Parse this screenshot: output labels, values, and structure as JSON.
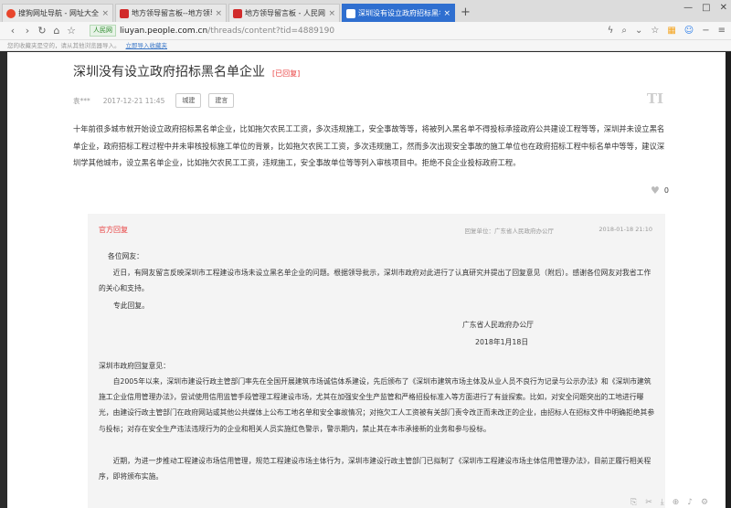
{
  "browser": {
    "tabs": [
      {
        "title": "搜狗网址导航 - 网址大全,实用",
        "favicon_color": "#e8452c",
        "active": false
      },
      {
        "title": "地方领导留言板--地方领导--人民",
        "favicon_color": "#d12b2b",
        "active": false
      },
      {
        "title": "地方领导留言板 - 人民网",
        "favicon_color": "#d12b2b",
        "active": false
      },
      {
        "title": "深圳没有设立政府招标黑名单企",
        "favicon_color": "#ffffff",
        "active": true
      }
    ],
    "new_tab": "+",
    "url_badge": "人民网",
    "url_host": "liuyan.people.com.cn",
    "url_path": "/threads/content?tid=4889190",
    "bookmark_hint": "您的收藏夹是空的，请从其他浏览器导入。",
    "bookmark_import": "立即导入收藏夹"
  },
  "thread": {
    "title": "深圳没有设立政府招标黑名单企业",
    "status": "[已回复]",
    "author": "袁***",
    "date": "2017-12-21 11:45",
    "tags": [
      "城建",
      "建言"
    ],
    "watermark": "TI",
    "content": "十年前很多城市就开始设立政府招标黑名单企业，比如拖欠农民工工资，多次违规施工，安全事故等等，将被列入黑名单不得投标承接政府公共建设工程等等，深圳并未设立黑名单企业，政府招标工程过程中并未审核投标施工单位的背景，比如拖欠农民工工资，多次违规施工，然而多次出现安全事故的施工单位也在政府招标工程中标名单中等等，建议深圳学其他城市，设立黑名单企业，比如拖欠农民工工资，违规施工，安全事故单位等等列入审核项目中。拒绝不良企业投标政府工程。",
    "likes": "0"
  },
  "reply": {
    "heading": "官方回复",
    "unit": "回复单位：广东省人民政府办公厅",
    "date": "2018-01-18 21:10",
    "salutation": "各位网友：",
    "paragraph1": "近日，有网友留言反映深圳市工程建设市场未设立黑名单企业的问题。根据领导批示，深圳市政府对此进行了认真研究并提出了回复意见（附后）。感谢各位网友对我省工作的关心和支持。",
    "closing": "专此回复。",
    "signature_org": "广东省人民政府办公厅",
    "signature_date": "2018年1月18日",
    "sub_heading": "深圳市政府回复意见：",
    "paragraph2": "自2005年以来，深圳市建设行政主管部门率先在全国开展建筑市场诚信体系建设，先后颁布了《深圳市建筑市场主体及从业人员不良行为记录与公示办法》和《深圳市建筑施工企业信用管理办法》，尝试使用信用监管手段管理工程建设市场，尤其在加强安全生产监管和严格招投标准入等方面进行了有益探索。比如，对安全问题突出的工地进行曝光，由建设行政主管部门在政府网站或其他公共媒体上公布工地名单和安全事故情况；对拖欠工人工资被有关部门责令改正而未改正的企业，由招标人在招标文件中明确拒绝其参与投标；对存在安全生产违法违规行为的企业和相关人员实施红色警示，警示期内，禁止其在本市承接新的业务和参与投标。",
    "paragraph3": "近期，为进一步推动工程建设市场信用管理，规范工程建设市场主体行为，深圳市建设行政主管部门已拟制了《深圳市工程建设市场主体信用管理办法》，目前正履行相关程序，即将颁布实施。"
  }
}
